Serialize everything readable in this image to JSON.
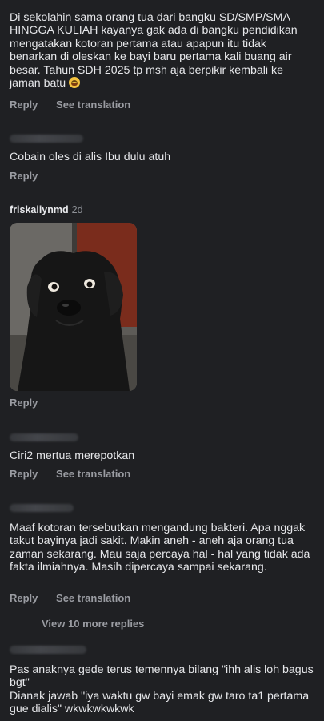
{
  "comments": [
    {
      "text": "Di sekolahin sama orang tua dari bangku SD/SMP/SMA HINGGA KULIAH kayanya gak ada di bangku pendidikan mengatakan kotoran pertama atau apapun itu tidak benarkan di oleskan ke bayi baru pertama kali buang air besar. Tahun SDH 2025 tp msh aja berpikir kembali ke jaman batu",
      "emoji": "grinning-sweat-emoji",
      "reply": "Reply",
      "translate": "See translation"
    },
    {
      "text": "Cobain oles di alis Ibu dulu atuh",
      "reply": "Reply"
    },
    {
      "username": "friskaiiynmd",
      "time": "2d",
      "media": "black dog photo",
      "reply": "Reply"
    },
    {
      "text": "Ciri2 mertua merepotkan",
      "reply": "Reply",
      "translate": "See translation"
    },
    {
      "text": "Maaf kotoran tersebutkan mengandung bakteri. Apa nggak takut bayinya jadi sakit. Makin aneh - aneh aja orang tua zaman sekarang. Mau saja percaya hal - hal yang tidak ada fakta ilmiahnya. Masih dipercaya sampai sekarang.",
      "reply": "Reply",
      "translate": "See translation"
    },
    {
      "text": "Pas anaknya gede terus temennya bilang \"ihh alis loh bagus bgt\"\nDianak jawab \"iya waktu gw bayi emak gw taro ta1 pertama gue dialis\" wkwkwkwkwk"
    }
  ],
  "view_more": "View 10 more replies",
  "colors": {
    "background": "#1f2023",
    "muted": "#9a9ca2",
    "text": "#e6e7ea"
  }
}
